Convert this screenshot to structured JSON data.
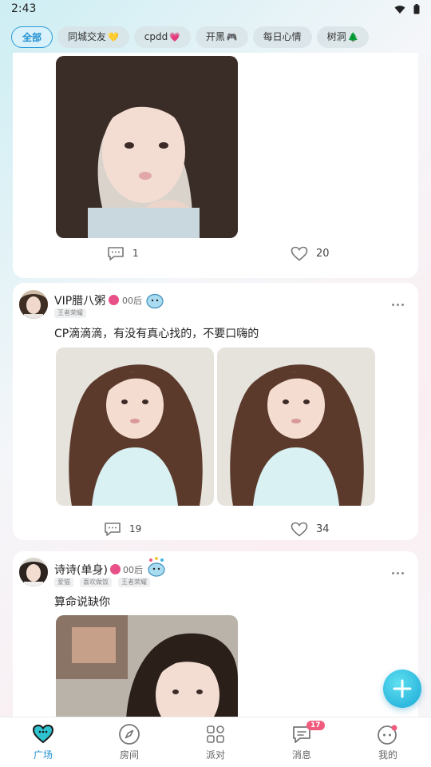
{
  "status_bar": {
    "time": "2:43"
  },
  "tabs": [
    {
      "label": "全部",
      "emoji": ""
    },
    {
      "label": "同城交友",
      "emoji": "💛"
    },
    {
      "label": "cpdd",
      "emoji": "💗"
    },
    {
      "label": "开黑",
      "emoji": "🎮"
    },
    {
      "label": "每日心情",
      "emoji": ""
    },
    {
      "label": "树洞",
      "emoji": "🌲"
    }
  ],
  "posts": [
    {
      "comments": "1",
      "likes": "20"
    },
    {
      "username": "VIP腊八粥",
      "generation": "00后",
      "tags": [
        "王者荣耀"
      ],
      "text": "CP滴滴滴，有没有真心找的，不要口嗨的",
      "comments": "19",
      "likes": "34"
    },
    {
      "username": "诗诗(单身)",
      "generation": "00后",
      "tags": [
        "爱猫",
        "喜欢做饭",
        "王者荣耀"
      ],
      "text": "算命说缺你"
    }
  ],
  "nav": [
    {
      "label": "广场"
    },
    {
      "label": "房间"
    },
    {
      "label": "派对"
    },
    {
      "label": "消息",
      "badge": "17"
    },
    {
      "label": "我的"
    }
  ],
  "colors": {
    "accent": "#1f8fd0",
    "badge": "#f15b7d",
    "fab": "#1aa8d8"
  }
}
